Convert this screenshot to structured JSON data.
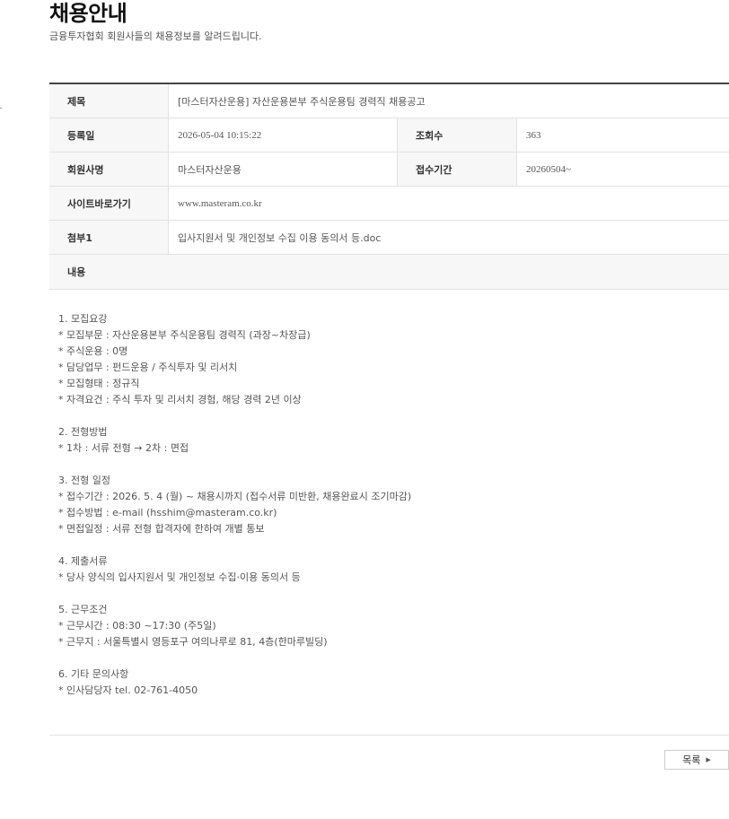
{
  "header": {
    "title": "채용안내",
    "description": "금융투자협회 회원사들의 채용정보를 알려드립니다."
  },
  "detail": {
    "title_label": "제목",
    "title_value": "[마스터자산운용] 자산운용본부 주식운용팀 경력직 채용공고",
    "date_label": "등록일",
    "date_value": "2026-05-04 10:15:22",
    "views_label": "조회수",
    "views_value": "363",
    "company_label": "회원사명",
    "company_value": "마스터자산운용",
    "period_label": "접수기간",
    "period_value": "20260504~",
    "site_label": "사이트바로가기",
    "site_value": "www.masteram.co.kr",
    "attachment_label": "첨부1",
    "attachment_value": "입사지원서 및 개인정보 수집 이용 동의서 등.doc",
    "content_label": "내용"
  },
  "content": {
    "lines": [
      "1. 모집요강",
      "* 모집부문 : 자산운용본부 주식운용팀 경력직 (과장~차장급)",
      "* 주식운용 : 0명",
      "* 담당업무 : 펀드운용 / 주식투자 및 리서치",
      "* 모집형태 : 정규직",
      "* 자격요건 : 주식 투자 및 리서치 경험, 해당 경력 2년 이상",
      "",
      "2. 전형방법",
      "* 1차 : 서류 전형 → 2차 : 면접",
      "",
      "3. 전형 일정",
      "* 접수기간 : 2026. 5. 4 (월) ~ 채용시까지 (접수서류 미반환, 채용완료시 조기마감)",
      "* 접수방법 : e-mail (hsshim@masteram.co.kr)",
      "* 면접일정 : 서류 전형 합격자에 한하여 개별 통보",
      "",
      "4. 제출서류",
      "* 당사 양식의 입사지원서 및 개인정보 수집·이용 동의서 등",
      "",
      "5. 근무조건",
      "* 근무시간 : 08:30 ~17:30 (주5일)",
      "* 근무지 : 서울특별시 영등포구 여의나루로 81, 4층(한마루빌딩)",
      "",
      "6. 기타 문의사항",
      "* 인사담당자 tel. 02-761-4050"
    ]
  },
  "footer": {
    "list_button_label": "목록",
    "list_button_icon": "triangle-right-icon"
  }
}
